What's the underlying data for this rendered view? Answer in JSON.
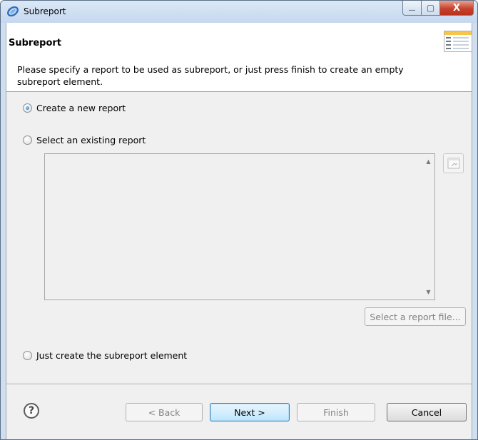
{
  "window": {
    "title": "Subreport",
    "minimize_symbol": "—",
    "maximize_symbol": "▢",
    "close_symbol": "X"
  },
  "header": {
    "title": "Subreport",
    "description": "Please specify a report to be used as subreport, or just press finish to create an empty subreport element."
  },
  "options": {
    "create_new": {
      "label": "Create a new report",
      "selected": true
    },
    "select_existing": {
      "label": "Select an existing report",
      "selected": false
    },
    "just_create": {
      "label": "Just create the subreport element",
      "selected": false
    }
  },
  "report_list": {
    "items": []
  },
  "buttons": {
    "select_file": "Select a report file...",
    "help": "?",
    "back": "< Back",
    "next": "Next >",
    "finish": "Finish",
    "cancel": "Cancel"
  },
  "icons": {
    "window_icon": "eclipse-icon",
    "header_image": "wizard-banner-icon",
    "browse_icon": "browse-icon",
    "scroll_up": "scroll-up-icon",
    "scroll_down": "scroll-down-icon"
  },
  "colors": {
    "titlebar": "#cfdff0",
    "close_button": "#c7422c",
    "default_button_border": "#3c7fb1",
    "dialog_background": "#f0f0f0"
  }
}
